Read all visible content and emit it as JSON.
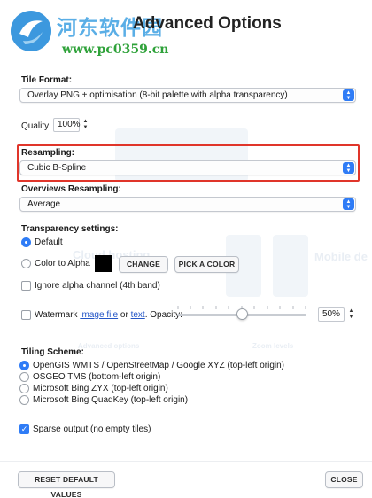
{
  "watermark": {
    "site_name": "河东软件园",
    "url": "www.pc0359.cn"
  },
  "dialog": {
    "title": "Advanced Options"
  },
  "background": {
    "ghost_labels": [
      "Cloud hosting",
      "Mobile de",
      "Advanced options",
      "Zoom levels"
    ]
  },
  "tile_format": {
    "label": "Tile Format:",
    "value": "Overlay PNG + optimisation (8-bit palette with alpha transparency)"
  },
  "quality": {
    "label": "Quality:",
    "value": "100%"
  },
  "resampling": {
    "label": "Resampling:",
    "value": "Cubic B-Spline"
  },
  "overviews_resampling": {
    "label": "Overviews Resampling:",
    "value": "Average"
  },
  "transparency": {
    "label": "Transparency settings:",
    "default_label": "Default",
    "color_to_alpha_label": "Color to Alpha",
    "change_button": "CHANGE",
    "pick_color_button": "PICK A COLOR",
    "ignore_alpha_label": "Ignore alpha channel (4th band)",
    "swatch_color": "#000000"
  },
  "watermark_opt": {
    "label_pre": "Watermark",
    "image_file_link": "image file",
    "or_text": "or",
    "text_link": "text",
    "opacity_label": ". Opacity:",
    "opacity_value": "50%"
  },
  "tiling": {
    "label": "Tiling Scheme:",
    "options": [
      "OpenGIS WMTS / OpenStreetMap / Google XYZ (top-left origin)",
      "OSGEO TMS (bottom-left origin)",
      "Microsoft Bing ZYX (top-left origin)",
      "Microsoft Bing QuadKey (top-left origin)"
    ],
    "selected_index": 0
  },
  "sparse_output": {
    "label": "Sparse output (no empty tiles)",
    "checked": true
  },
  "footer": {
    "reset_button": "RESET DEFAULT VALUES",
    "close_button": "CLOSE"
  },
  "colors": {
    "accent": "#2f7cf6",
    "highlight_border": "#e0352a",
    "link": "#2456c7"
  }
}
